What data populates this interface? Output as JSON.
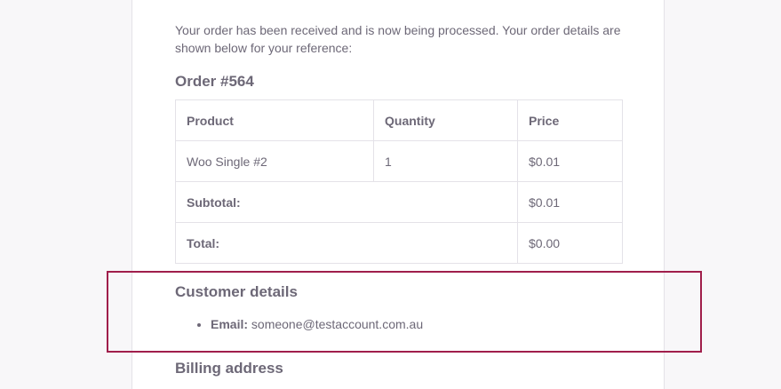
{
  "email": {
    "intro_text": "Your order has been received and is now being processed. Your order details are shown below for your reference:",
    "order_title": "Order #564",
    "table": {
      "headers": [
        "Product",
        "Quantity",
        "Price"
      ],
      "rows": [
        {
          "product": "Woo Single #2",
          "quantity": "1",
          "price": "$0.01"
        }
      ],
      "totals": [
        {
          "label": "Subtotal:",
          "value": "$0.01"
        },
        {
          "label": "Total:",
          "value": "$0.00"
        }
      ]
    },
    "customer_details": {
      "title": "Customer details",
      "email_label": "Email:",
      "email_value": "someone@testaccount.com.au"
    },
    "billing_title": "Billing address"
  },
  "colors": {
    "highlight_border": "#a01e4b",
    "text": "#6d6877",
    "border": "#e4e2e8"
  }
}
